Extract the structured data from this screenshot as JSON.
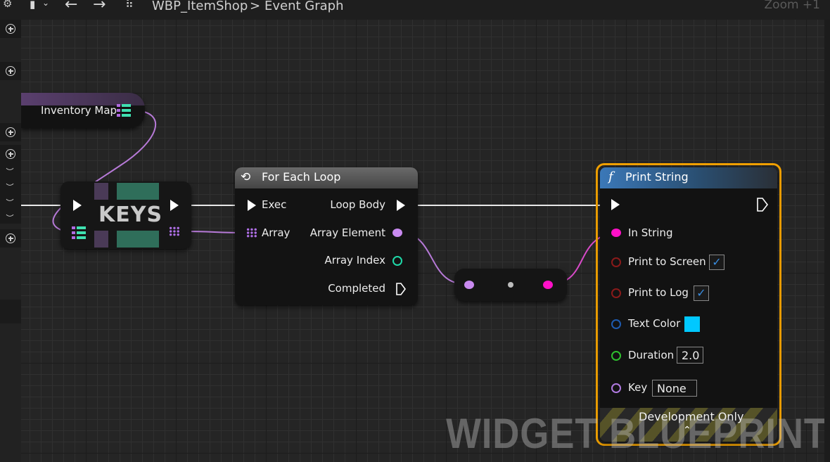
{
  "topbar": {
    "breadcrumb_asset": "WBP_ItemShop",
    "breadcrumb_separator": ">",
    "breadcrumb_graph": "Event Graph",
    "zoom": "Zoom +1"
  },
  "nodes": {
    "inventory_map": {
      "label": "Inventory Map"
    },
    "keys": {
      "title": "KEYS"
    },
    "for_each_loop": {
      "title": "For Each Loop",
      "inputs": [
        "Exec",
        "Array"
      ],
      "outputs": [
        "Loop Body",
        "Array Element",
        "Array Index",
        "Completed"
      ]
    },
    "print_string": {
      "title": "Print String",
      "in_string": "In String",
      "print_to_screen": {
        "label": "Print to Screen",
        "checked": true
      },
      "print_to_log": {
        "label": "Print to Log",
        "checked": true
      },
      "text_color": {
        "label": "Text Color",
        "color": "#00c8ff"
      },
      "duration": {
        "label": "Duration",
        "value": "2.0"
      },
      "key": {
        "label": "Key",
        "value": "None"
      },
      "footer": "Development Only"
    }
  },
  "watermark": "WIDGET BLUEPRINT",
  "colors": {
    "background": "#252525",
    "exec_wire": "#ffffff",
    "map_wire": "#c77ddf",
    "string_pin": "#ff10c8",
    "selection": "#f0a000"
  }
}
